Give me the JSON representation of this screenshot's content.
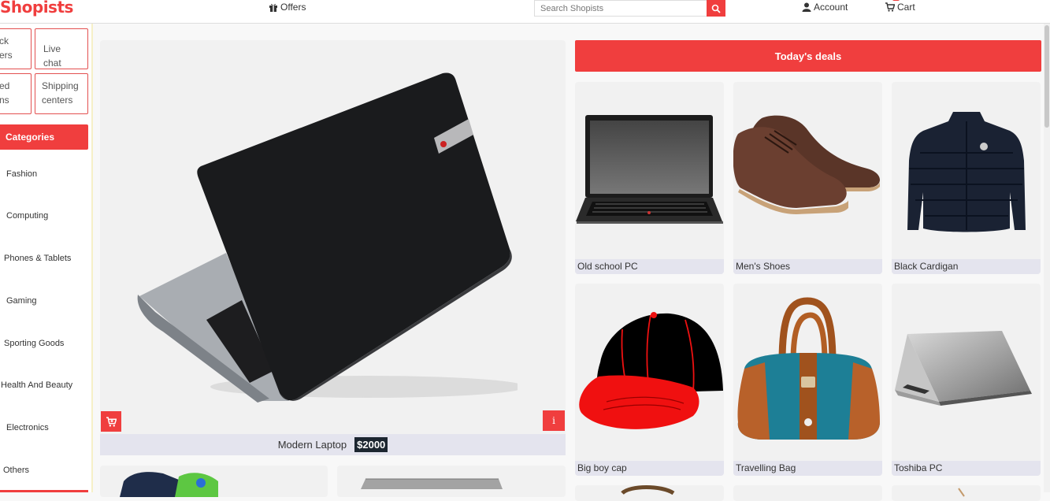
{
  "header": {
    "brand": "Shopists",
    "offers_label": "Offers",
    "search_placeholder": "Search Shopists",
    "account_label": "Account",
    "cart_label": "Cart"
  },
  "sidebar": {
    "quick_links": [
      {
        "line1": "ck",
        "line2": "ers"
      },
      {
        "line1": "Live chat",
        "line2": ""
      },
      {
        "line1": "ed",
        "line2": "ns"
      },
      {
        "line1": "Shipping",
        "line2": "centers"
      }
    ],
    "categories_title": "Categories",
    "categories": [
      "Fashion",
      "Computing",
      "Phones & Tablets",
      "Gaming",
      "Sporting Goods",
      "Health And Beauty",
      "Electronics",
      "Others"
    ]
  },
  "featured": {
    "name": "Modern Laptop",
    "price": "$2000",
    "info_label": "i"
  },
  "deals": {
    "title": "Today's deals",
    "items": [
      {
        "name": "Old school PC",
        "icon": "laptop-icon"
      },
      {
        "name": "Men's Shoes",
        "icon": "shoe-icon"
      },
      {
        "name": "Black Cardigan",
        "icon": "jacket-icon"
      },
      {
        "name": "Big boy cap",
        "icon": "cap-icon"
      },
      {
        "name": "Travelling Bag",
        "icon": "handbag-icon"
      },
      {
        "name": "Toshiba PC",
        "icon": "laptop-icon"
      }
    ]
  },
  "colors": {
    "accent": "#f03e3e",
    "price_bg": "#1c2630",
    "card_bg": "#f1f1f1",
    "label_bg": "#e4e4ee"
  }
}
